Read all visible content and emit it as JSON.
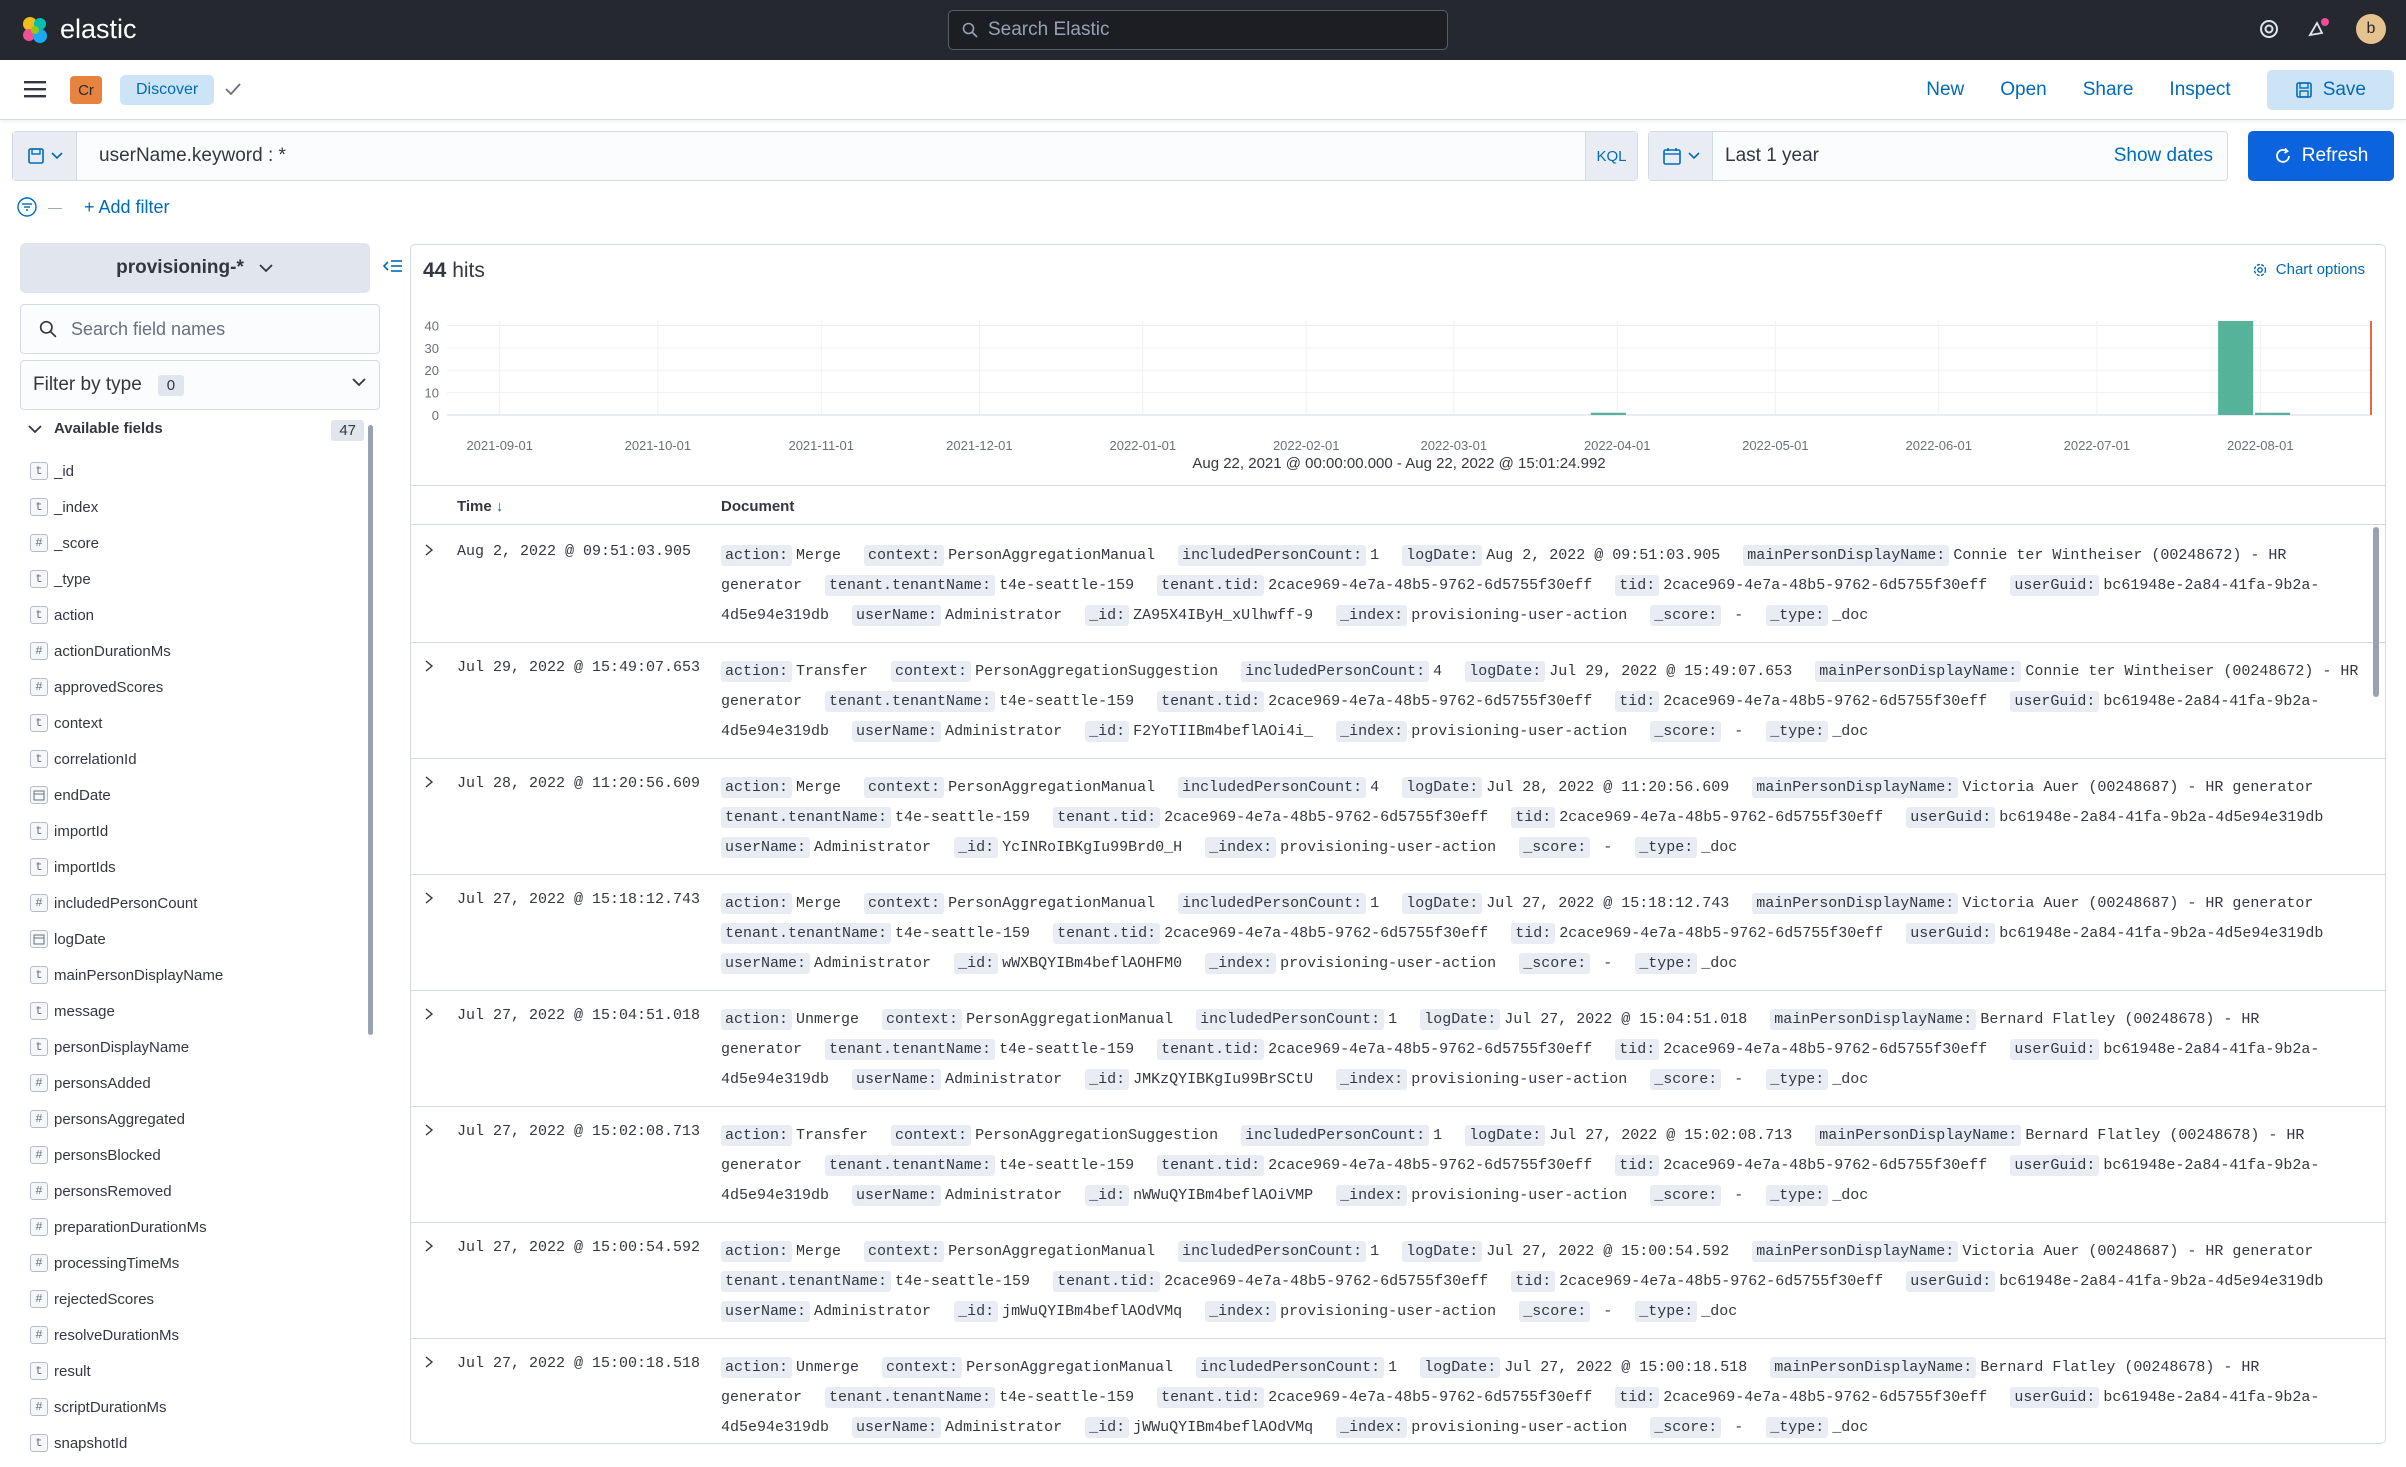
{
  "topbar": {
    "brand": "elastic",
    "search_placeholder": "Search Elastic",
    "user_initial": "b"
  },
  "subbar": {
    "space_initials": "Cr",
    "breadcrumb": "Discover",
    "actions": [
      "New",
      "Open",
      "Share",
      "Inspect"
    ],
    "save_label": "Save"
  },
  "query": {
    "text": "userName.keyword : *",
    "language": "KQL"
  },
  "date": {
    "range": "Last 1 year",
    "show_dates": "Show dates",
    "refresh": "Refresh"
  },
  "filters": {
    "add_filter": "+ Add filter"
  },
  "sidebar": {
    "index_pattern": "provisioning-*",
    "search_placeholder": "Search field names",
    "filter_by_type": "Filter by type",
    "filter_count": "0",
    "available_label": "Available fields",
    "available_count": "47",
    "fields": [
      {
        "type": "t",
        "name": "_id"
      },
      {
        "type": "t",
        "name": "_index"
      },
      {
        "type": "#",
        "name": "_score"
      },
      {
        "type": "t",
        "name": "_type"
      },
      {
        "type": "t",
        "name": "action"
      },
      {
        "type": "#",
        "name": "actionDurationMs"
      },
      {
        "type": "#",
        "name": "approvedScores"
      },
      {
        "type": "t",
        "name": "context"
      },
      {
        "type": "t",
        "name": "correlationId"
      },
      {
        "type": "date",
        "name": "endDate"
      },
      {
        "type": "t",
        "name": "importId"
      },
      {
        "type": "t",
        "name": "importIds"
      },
      {
        "type": "#",
        "name": "includedPersonCount"
      },
      {
        "type": "date",
        "name": "logDate"
      },
      {
        "type": "t",
        "name": "mainPersonDisplayName"
      },
      {
        "type": "t",
        "name": "message"
      },
      {
        "type": "t",
        "name": "personDisplayName"
      },
      {
        "type": "#",
        "name": "personsAdded"
      },
      {
        "type": "#",
        "name": "personsAggregated"
      },
      {
        "type": "#",
        "name": "personsBlocked"
      },
      {
        "type": "#",
        "name": "personsRemoved"
      },
      {
        "type": "#",
        "name": "preparationDurationMs"
      },
      {
        "type": "#",
        "name": "processingTimeMs"
      },
      {
        "type": "#",
        "name": "rejectedScores"
      },
      {
        "type": "#",
        "name": "resolveDurationMs"
      },
      {
        "type": "t",
        "name": "result"
      },
      {
        "type": "#",
        "name": "scriptDurationMs"
      },
      {
        "type": "t",
        "name": "snapshotId"
      }
    ]
  },
  "results": {
    "hits_count": "44",
    "hits_label": "hits",
    "chart_options": "Chart options",
    "range_label": "Aug 22, 2021 @ 00:00:00.000 - Aug 22, 2022 @ 15:01:24.992",
    "col_time": "Time",
    "col_document": "Document"
  },
  "chart_data": {
    "type": "bar",
    "y_ticks": [
      "40",
      "30",
      "20",
      "10",
      "0"
    ],
    "x_ticks": [
      "2021-09-01",
      "2021-10-01",
      "2021-11-01",
      "2021-12-01",
      "2022-01-01",
      "2022-02-01",
      "2022-03-01",
      "2022-04-01",
      "2022-05-01",
      "2022-06-01",
      "2022-07-01",
      "2022-08-01"
    ],
    "ylim": [
      0,
      42
    ],
    "xlim": [
      "2021-08-22",
      "2022-08-22"
    ],
    "bars": [
      {
        "x": "2022-03-27",
        "value": 1
      },
      {
        "x": "2022-07-24",
        "value": 42
      },
      {
        "x": "2022-07-31",
        "value": 1
      }
    ],
    "bar_color": "#54b399",
    "now_marker_color": "#e7664c",
    "grid": true
  },
  "rows": [
    {
      "time": "Aug 2, 2022 @ 09:51:03.905",
      "fields": [
        [
          "action:",
          "Merge"
        ],
        [
          "context:",
          "PersonAggregationManual"
        ],
        [
          "includedPersonCount:",
          "1"
        ],
        [
          "logDate:",
          "Aug 2, 2022 @ 09:51:03.905"
        ],
        [
          "mainPersonDisplayName:",
          "Connie ter Wintheiser (00248672) - HR generator"
        ],
        [
          "tenant.tenantName:",
          "t4e-seattle-159"
        ],
        [
          "tenant.tid:",
          "2cace969-4e7a-48b5-9762-6d5755f30eff"
        ],
        [
          "tid:",
          "2cace969-4e7a-48b5-9762-6d5755f30eff"
        ],
        [
          "userGuid:",
          "bc61948e-2a84-41fa-9b2a-4d5e94e319db"
        ],
        [
          "userName:",
          "Administrator"
        ],
        [
          "_id:",
          "ZA95X4IByH_xUlhwff-9"
        ],
        [
          "_index:",
          "provisioning-user-action"
        ],
        [
          "_score:",
          " - "
        ],
        [
          "_type:",
          "_doc"
        ]
      ]
    },
    {
      "time": "Jul 29, 2022 @ 15:49:07.653",
      "fields": [
        [
          "action:",
          "Transfer"
        ],
        [
          "context:",
          "PersonAggregationSuggestion"
        ],
        [
          "includedPersonCount:",
          "4"
        ],
        [
          "logDate:",
          "Jul 29, 2022 @ 15:49:07.653"
        ],
        [
          "mainPersonDisplayName:",
          "Connie ter Wintheiser (00248672) - HR generator"
        ],
        [
          "tenant.tenantName:",
          "t4e-seattle-159"
        ],
        [
          "tenant.tid:",
          "2cace969-4e7a-48b5-9762-6d5755f30eff"
        ],
        [
          "tid:",
          "2cace969-4e7a-48b5-9762-6d5755f30eff"
        ],
        [
          "userGuid:",
          "bc61948e-2a84-41fa-9b2a-4d5e94e319db"
        ],
        [
          "userName:",
          "Administrator"
        ],
        [
          "_id:",
          "F2YoTIIBm4beflAOi4i_"
        ],
        [
          "_index:",
          "provisioning-user-action"
        ],
        [
          "_score:",
          " - "
        ],
        [
          "_type:",
          "_doc"
        ]
      ]
    },
    {
      "time": "Jul 28, 2022 @ 11:20:56.609",
      "fields": [
        [
          "action:",
          "Merge"
        ],
        [
          "context:",
          "PersonAggregationManual"
        ],
        [
          "includedPersonCount:",
          "4"
        ],
        [
          "logDate:",
          "Jul 28, 2022 @ 11:20:56.609"
        ],
        [
          "mainPersonDisplayName:",
          "Victoria Auer (00248687) - HR generator"
        ],
        [
          "tenant.tenantName:",
          "t4e-seattle-159"
        ],
        [
          "tenant.tid:",
          "2cace969-4e7a-48b5-9762-6d5755f30eff"
        ],
        [
          "tid:",
          "2cace969-4e7a-48b5-9762-6d5755f30eff"
        ],
        [
          "userGuid:",
          "bc61948e-2a84-41fa-9b2a-4d5e94e319db"
        ],
        [
          "userName:",
          "Administrator"
        ],
        [
          "_id:",
          "YcINRoIBKgIu99Brd0_H"
        ],
        [
          "_index:",
          "provisioning-user-action"
        ],
        [
          "_score:",
          " - "
        ],
        [
          "_type:",
          "_doc"
        ]
      ]
    },
    {
      "time": "Jul 27, 2022 @ 15:18:12.743",
      "fields": [
        [
          "action:",
          "Merge"
        ],
        [
          "context:",
          "PersonAggregationManual"
        ],
        [
          "includedPersonCount:",
          "1"
        ],
        [
          "logDate:",
          "Jul 27, 2022 @ 15:18:12.743"
        ],
        [
          "mainPersonDisplayName:",
          "Victoria Auer (00248687) - HR generator"
        ],
        [
          "tenant.tenantName:",
          "t4e-seattle-159"
        ],
        [
          "tenant.tid:",
          "2cace969-4e7a-48b5-9762-6d5755f30eff"
        ],
        [
          "tid:",
          "2cace969-4e7a-48b5-9762-6d5755f30eff"
        ],
        [
          "userGuid:",
          "bc61948e-2a84-41fa-9b2a-4d5e94e319db"
        ],
        [
          "userName:",
          "Administrator"
        ],
        [
          "_id:",
          "wWXBQYIBm4beflAOHFM0"
        ],
        [
          "_index:",
          "provisioning-user-action"
        ],
        [
          "_score:",
          " - "
        ],
        [
          "_type:",
          "_doc"
        ]
      ]
    },
    {
      "time": "Jul 27, 2022 @ 15:04:51.018",
      "fields": [
        [
          "action:",
          "Unmerge"
        ],
        [
          "context:",
          "PersonAggregationManual"
        ],
        [
          "includedPersonCount:",
          "1"
        ],
        [
          "logDate:",
          "Jul 27, 2022 @ 15:04:51.018"
        ],
        [
          "mainPersonDisplayName:",
          "Bernard Flatley (00248678) - HR generator"
        ],
        [
          "tenant.tenantName:",
          "t4e-seattle-159"
        ],
        [
          "tenant.tid:",
          "2cace969-4e7a-48b5-9762-6d5755f30eff"
        ],
        [
          "tid:",
          "2cace969-4e7a-48b5-9762-6d5755f30eff"
        ],
        [
          "userGuid:",
          "bc61948e-2a84-41fa-9b2a-4d5e94e319db"
        ],
        [
          "userName:",
          "Administrator"
        ],
        [
          "_id:",
          "JMKzQYIBKgIu99BrSCtU"
        ],
        [
          "_index:",
          "provisioning-user-action"
        ],
        [
          "_score:",
          " - "
        ],
        [
          "_type:",
          "_doc"
        ]
      ]
    },
    {
      "time": "Jul 27, 2022 @ 15:02:08.713",
      "fields": [
        [
          "action:",
          "Transfer"
        ],
        [
          "context:",
          "PersonAggregationSuggestion"
        ],
        [
          "includedPersonCount:",
          "1"
        ],
        [
          "logDate:",
          "Jul 27, 2022 @ 15:02:08.713"
        ],
        [
          "mainPersonDisplayName:",
          "Bernard Flatley (00248678) - HR generator"
        ],
        [
          "tenant.tenantName:",
          "t4e-seattle-159"
        ],
        [
          "tenant.tid:",
          "2cace969-4e7a-48b5-9762-6d5755f30eff"
        ],
        [
          "tid:",
          "2cace969-4e7a-48b5-9762-6d5755f30eff"
        ],
        [
          "userGuid:",
          "bc61948e-2a84-41fa-9b2a-4d5e94e319db"
        ],
        [
          "userName:",
          "Administrator"
        ],
        [
          "_id:",
          "nWWuQYIBm4beflAOiVMP"
        ],
        [
          "_index:",
          "provisioning-user-action"
        ],
        [
          "_score:",
          " - "
        ],
        [
          "_type:",
          "_doc"
        ]
      ]
    },
    {
      "time": "Jul 27, 2022 @ 15:00:54.592",
      "fields": [
        [
          "action:",
          "Merge"
        ],
        [
          "context:",
          "PersonAggregationManual"
        ],
        [
          "includedPersonCount:",
          "1"
        ],
        [
          "logDate:",
          "Jul 27, 2022 @ 15:00:54.592"
        ],
        [
          "mainPersonDisplayName:",
          "Victoria Auer (00248687) - HR generator"
        ],
        [
          "tenant.tenantName:",
          "t4e-seattle-159"
        ],
        [
          "tenant.tid:",
          "2cace969-4e7a-48b5-9762-6d5755f30eff"
        ],
        [
          "tid:",
          "2cace969-4e7a-48b5-9762-6d5755f30eff"
        ],
        [
          "userGuid:",
          "bc61948e-2a84-41fa-9b2a-4d5e94e319db"
        ],
        [
          "userName:",
          "Administrator"
        ],
        [
          "_id:",
          "jmWuQYIBm4beflAOdVMq"
        ],
        [
          "_index:",
          "provisioning-user-action"
        ],
        [
          "_score:",
          " - "
        ],
        [
          "_type:",
          "_doc"
        ]
      ]
    },
    {
      "time": "Jul 27, 2022 @ 15:00:18.518",
      "fields": [
        [
          "action:",
          "Unmerge"
        ],
        [
          "context:",
          "PersonAggregationManual"
        ],
        [
          "includedPersonCount:",
          "1"
        ],
        [
          "logDate:",
          "Jul 27, 2022 @ 15:00:18.518"
        ],
        [
          "mainPersonDisplayName:",
          "Bernard Flatley (00248678) - HR generator"
        ],
        [
          "tenant.tenantName:",
          "t4e-seattle-159"
        ],
        [
          "tenant.tid:",
          "2cace969-4e7a-48b5-9762-6d5755f30eff"
        ],
        [
          "tid:",
          "2cace969-4e7a-48b5-9762-6d5755f30eff"
        ],
        [
          "userGuid:",
          "bc61948e-2a84-41fa-9b2a-4d5e94e319db"
        ],
        [
          "userName:",
          "Administrator"
        ],
        [
          "_id:",
          "jWWuQYIBm4beflAOdVMq"
        ],
        [
          "_index:",
          "provisioning-user-action"
        ],
        [
          "_score:",
          " - "
        ],
        [
          "_type:",
          "_doc"
        ]
      ]
    }
  ]
}
